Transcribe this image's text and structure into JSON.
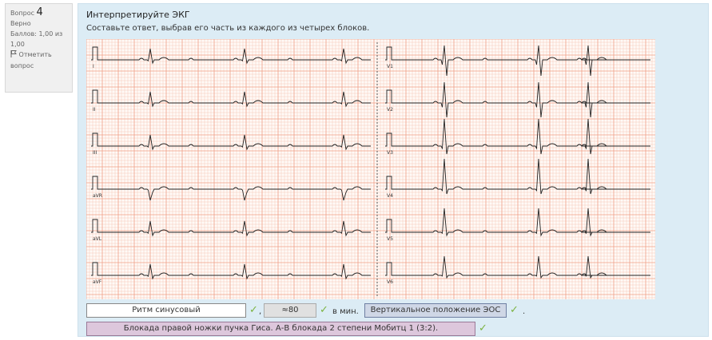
{
  "question": {
    "label": "Вопрос",
    "number": "4",
    "status": "Верно",
    "score_text": "Баллов: 1,00 из 1,00",
    "flag_label": "Отметить вопрос"
  },
  "content": {
    "title": "Интерпретируйте ЭКГ",
    "prompt": "Составьте ответ, выбрав его часть из каждого из четырех блоков."
  },
  "ecg": {
    "leads_left": [
      "I",
      "II",
      "III",
      "aVR",
      "aVL",
      "aVF"
    ],
    "leads_right": [
      "V1",
      "V2",
      "V3",
      "V4",
      "V5",
      "V6"
    ]
  },
  "answers": {
    "rhythm": "Ритм синусовый",
    "rate": "≈80",
    "rate_unit": "в мин.",
    "axis": "Вертикальное положение ЭОС",
    "conduction": "Блокада правой ножки пучка Гиса. А-В блокада 2 степени Мобитц 1 (3:2)."
  },
  "colors": {
    "grid_minor": "#f6c9b8",
    "grid_major": "#ef9f87",
    "trace": "#222222",
    "check": "#7cb342"
  }
}
